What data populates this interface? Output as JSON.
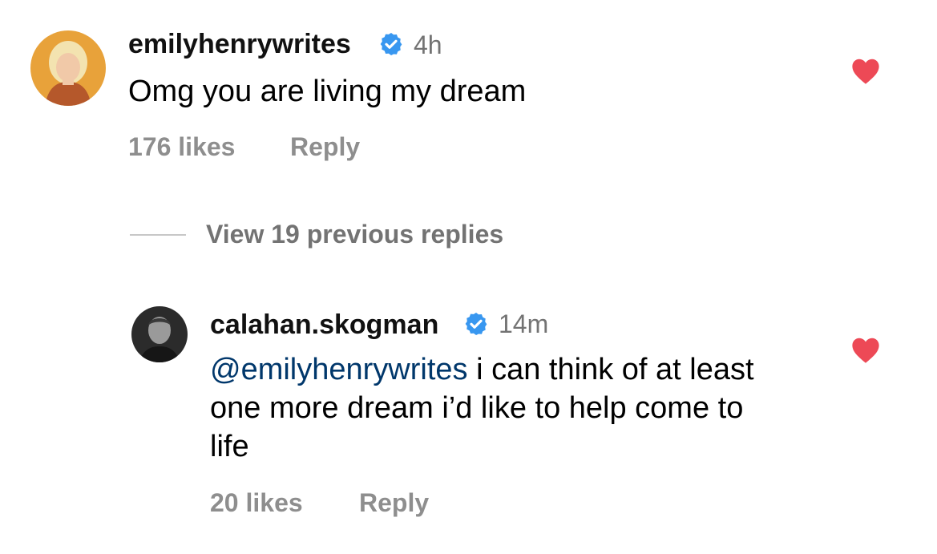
{
  "comment": {
    "username": "emilyhenrywrites",
    "time": "4h",
    "text": "Omg you are living my dream",
    "likes": "176 likes",
    "reply_label": "Reply",
    "liked": true
  },
  "view_replies": {
    "label": "View 19 previous replies"
  },
  "reply": {
    "username": "calahan.skogman",
    "time": "14m",
    "mention": "@emilyhenrywrites",
    "text": " i can think of at least one more dream i’d like to help come to life",
    "likes": "20 likes",
    "reply_label": "Reply",
    "liked": true
  },
  "colors": {
    "heart": "#ed4956",
    "verified": "#3897f0",
    "mention": "#00376b",
    "meta": "#8e8e8e",
    "avatar1_bg": "#e8a23a",
    "avatar2_bg": "#2b2b2b"
  },
  "icons": {
    "verified": "verified-badge-icon",
    "like": "heart-icon",
    "avatar": "avatar"
  }
}
